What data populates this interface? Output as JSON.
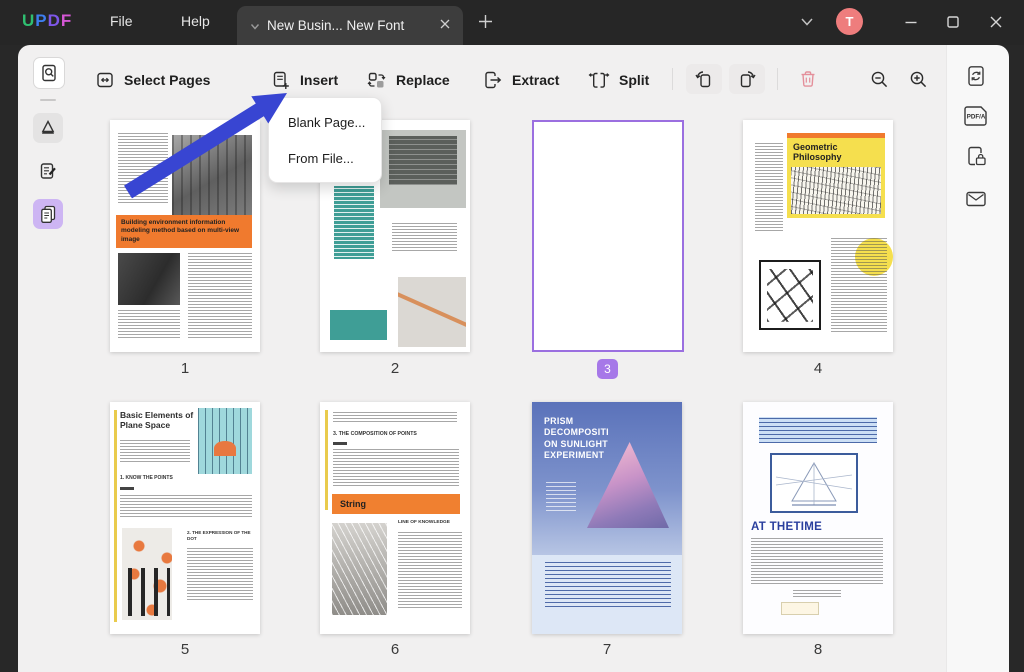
{
  "titlebar": {
    "logo_letters": [
      "U",
      "P",
      "D",
      "F"
    ],
    "menu_file": "File",
    "menu_help": "Help",
    "tab_label": "New Busin... New Font",
    "avatar_initial": "T"
  },
  "toolbar": {
    "select_pages_label": "Select Pages",
    "insert_label": "Insert",
    "replace_label": "Replace",
    "extract_label": "Extract",
    "split_label": "Split"
  },
  "insert_menu": {
    "items": [
      {
        "label": "Blank Page..."
      },
      {
        "label": "From File..."
      }
    ]
  },
  "sidebar_right": {
    "pdfa_label": "PDF/A"
  },
  "icons": [
    "search-page",
    "markup-pencil",
    "edit-note",
    "organize-pages",
    "select-pages",
    "insert-page",
    "replace-page",
    "extract-page",
    "split-page",
    "rotate-left",
    "rotate-right",
    "trash",
    "zoom-out",
    "zoom-in",
    "page-refresh",
    "pdfa",
    "page-lock",
    "mail",
    "new-tab",
    "tab-close",
    "chevron-down",
    "minimize",
    "maximize",
    "close"
  ],
  "pages": [
    {
      "number": "1",
      "banner": "Building environment information modeling method based on multi-view image"
    },
    {
      "number": "2"
    },
    {
      "number": "3",
      "selected": true
    },
    {
      "number": "4",
      "title": "Geometric Philosophy"
    },
    {
      "number": "5",
      "title": "Basic Elements of Plane Space",
      "heading1": "1. KNOW THE POINTS",
      "heading2": "2. THE EXPRESSION OF THE DOT"
    },
    {
      "number": "6",
      "heading1": "3. THE COMPOSITION OF POINTS",
      "banner": "String",
      "heading2": "LINE OF KNOWLEDGE"
    },
    {
      "number": "7",
      "title": "PRISM DECOMPOSITI ON SUNLIGHT EXPERIMENT"
    },
    {
      "number": "8",
      "title": "AT THETIME"
    }
  ],
  "colors": {
    "accent_purple": "#a678e8",
    "selection_border": "#9b6fe0",
    "arrow_blue": "#3845d2",
    "banner_orange": "#f07a2e",
    "teal": "#3f9e96",
    "banner_yellow": "#f5df4e",
    "trash_pink": "#e48f9a",
    "avatar_pink": "#ee7d7d",
    "logo_colors": [
      "#2fbf71",
      "#3d7ef0",
      "#7e57e8",
      "#d457d4"
    ]
  }
}
